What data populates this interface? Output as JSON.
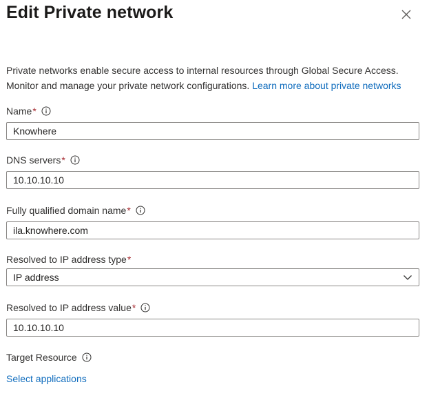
{
  "panel": {
    "title": "Edit Private network",
    "close_label": "Close"
  },
  "description": {
    "text": "Private networks enable secure access to internal resources through Global Secure Access. Monitor and manage your private network configurations.",
    "link_text": "Learn more about private networks"
  },
  "fields": {
    "name": {
      "label": "Name",
      "required": "*",
      "value": "Knowhere"
    },
    "dns": {
      "label": "DNS servers",
      "required": "*",
      "value": "10.10.10.10"
    },
    "fqdn": {
      "label": "Fully qualified domain name",
      "required": "*",
      "value": "ila.knowhere.com"
    },
    "ip_type": {
      "label": "Resolved to IP address type",
      "required": "*",
      "value": "IP address"
    },
    "ip_value": {
      "label": "Resolved to IP address value",
      "required": "*",
      "value": "10.10.10.10"
    },
    "target": {
      "label": "Target Resource",
      "link_text": "Select applications"
    }
  },
  "colors": {
    "link": "#0f6cbd",
    "required": "#a4262c",
    "border": "#8a8886"
  },
  "icons": [
    "close-icon",
    "info-icon",
    "chevron-down-icon"
  ]
}
